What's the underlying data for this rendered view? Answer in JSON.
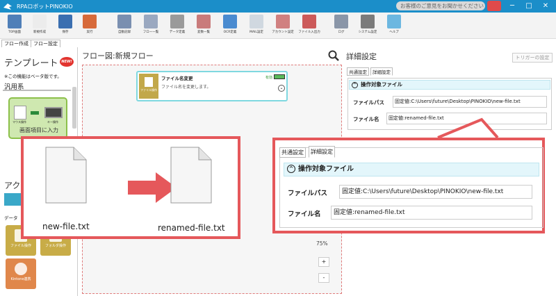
{
  "app": {
    "title": "RPAロボットPINOKIO",
    "feedback": "お客様のご意見をお聞かせください",
    "minimize": "─",
    "maximize": "□",
    "close": "✕"
  },
  "toolbar": [
    {
      "label": "TOP画面",
      "color": "#4f7fb8"
    },
    {
      "label": "新規作成",
      "color": "#ececec"
    },
    {
      "label": "保存",
      "color": "#3b6fb0"
    },
    {
      "label": "実行",
      "color": "#d76a3a"
    },
    {
      "label": "自動記録",
      "color": "#7a8fb0"
    },
    {
      "label": "フロー一覧",
      "color": "#9aa8c0"
    },
    {
      "label": "データ定義",
      "color": "#9a9a9a"
    },
    {
      "label": "変数一覧",
      "color": "#c97b7b"
    },
    {
      "label": "OCR定義",
      "color": "#4a8bd0"
    },
    {
      "label": "MAIL設定",
      "color": "#d0d8e0"
    },
    {
      "label": "アカウント設定",
      "color": "#d08080"
    },
    {
      "label": "ファイル入出力",
      "color": "#cc5a5a"
    },
    {
      "label": "ログ",
      "color": "#8a96a8"
    },
    {
      "label": "システム設定",
      "color": "#7b7b7b"
    },
    {
      "label": "ヘルプ",
      "color": "#6cb7e0"
    }
  ],
  "left_tabs": [
    "フロー作成",
    "フロー設定"
  ],
  "palette": {
    "title": "テンプレート",
    "badge": "NEW!",
    "beta_note": "※この機能はベータ版です。",
    "section": "汎用系",
    "card_caption": "画面項目に入力",
    "mouse_label": "マウス操作",
    "key_label": "キー操作",
    "action_title": "アク",
    "data_label": "データ",
    "tiles": [
      {
        "label": "ファイル操作",
        "color": "#c8ac47"
      },
      {
        "label": "フォルダ操作",
        "color": "#c8ac47"
      },
      {
        "label": "Kintone連携",
        "color": "#e0874b"
      }
    ]
  },
  "flow": {
    "title": "フロー図:新規フロー",
    "node_title": "ファイル名変更",
    "node_desc": "ファイル名を変更します。",
    "node_status": "有効",
    "node_icon_label": "ファイル操作",
    "zoom": "75%",
    "zoom_in": "+",
    "zoom_out": "-"
  },
  "detail": {
    "title": "詳細設定",
    "trigger_button": "トリガーの設定",
    "tabs": [
      "共通設定",
      "詳細設定"
    ],
    "section": "操作対象ファイル",
    "path_label": "ファイルパス",
    "path_value": "固定値:C:\\Users\\future\\Desktop\\PINOKIO\\new-file.txt",
    "name_label": "ファイル名",
    "name_value": "固定値:renamed-file.txt"
  },
  "overlay": {
    "before": "new-file.txt",
    "after": "renamed-file.txt",
    "accent": "#e5585b"
  }
}
